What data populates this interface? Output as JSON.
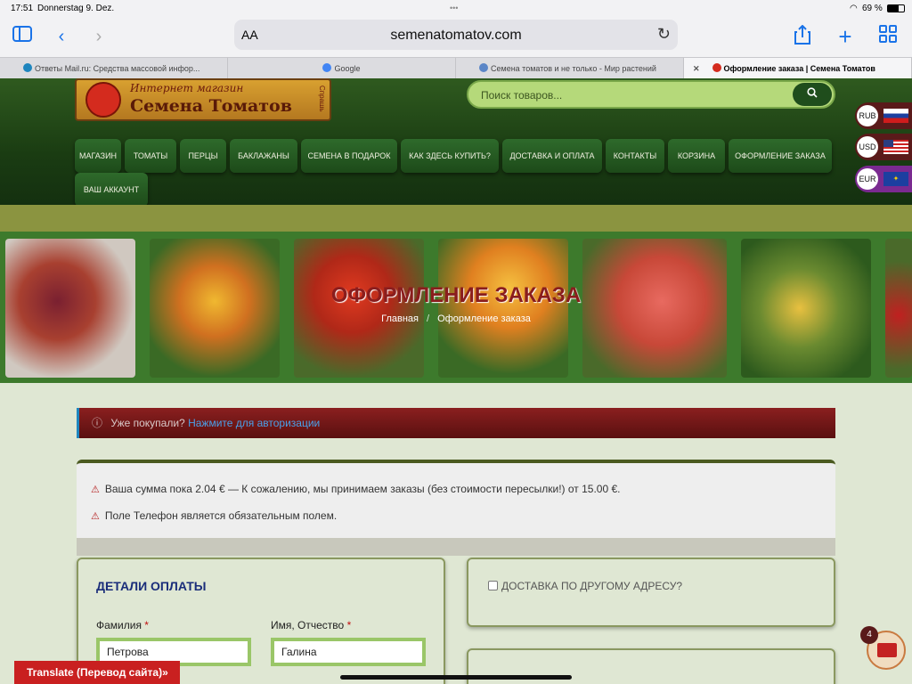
{
  "status_bar": {
    "time": "17:51",
    "date": "Donnerstag 9. Dez.",
    "battery": "69 %"
  },
  "browser": {
    "text_size_label": "AA",
    "url": "semenatomatov.com",
    "tabs": [
      {
        "title": "Ответы Mail.ru: Средства массовой инфор..."
      },
      {
        "title": "Google"
      },
      {
        "title": "Семена томатов и не только - Мир растений"
      },
      {
        "title": "Оформление заказа | Семена Томатов"
      }
    ]
  },
  "site": {
    "logo": {
      "line1": "Интернет магазин",
      "line2": "Семена Томатов",
      "line3": "Спрашь"
    },
    "search_placeholder": "Поиск товаров...",
    "nav": [
      "МАГАЗИН",
      "ТОМАТЫ",
      "ПЕРЦЫ",
      "БАКЛАЖАНЫ",
      "СЕМЕНА В ПОДАРОК",
      "КАК ЗДЕСЬ КУПИТЬ?",
      "ДОСТАВКА И ОПЛАТА",
      "КОНТАКТЫ",
      "КОРЗИНА",
      "ОФОРМЛЕНИЕ ЗАКАЗА",
      "ВАШ АККАУНТ"
    ],
    "currencies": [
      "RUB",
      "USD",
      "EUR"
    ],
    "banner": {
      "title": "ОФОРМЛЕНИЕ ЗАКАЗА",
      "crumb_home": "Главная",
      "crumb_sep": "/",
      "crumb_current": "Оформление заказа"
    }
  },
  "checkout": {
    "login_prompt": "Уже покупали?",
    "login_link": "Нажмите для авторизации",
    "notices": [
      "Ваша сумма пока 2.04 € — К сожалению, мы принимаем заказы (без стоимости пересылки!) от 15.00 €.",
      "Поле Телефон является обязательным полем."
    ],
    "billing": {
      "title": "ДЕТАЛИ ОПЛАТЫ",
      "last_name_label": "Фамилия",
      "last_name_value": "Петрова",
      "first_name_label": "Имя, Отчество",
      "first_name_value": "Галина",
      "required_mark": "*"
    },
    "ship_different": "ДОСТАВКА ПО ДРУГОМУ АДРЕСУ?"
  },
  "cart_count": "4",
  "translate_button": "Translate (Перевод сайта)»",
  "colors": {
    "accent_green": "#2e6a2b",
    "error_red": "#b52020",
    "title_blue": "#1a2d7a"
  }
}
